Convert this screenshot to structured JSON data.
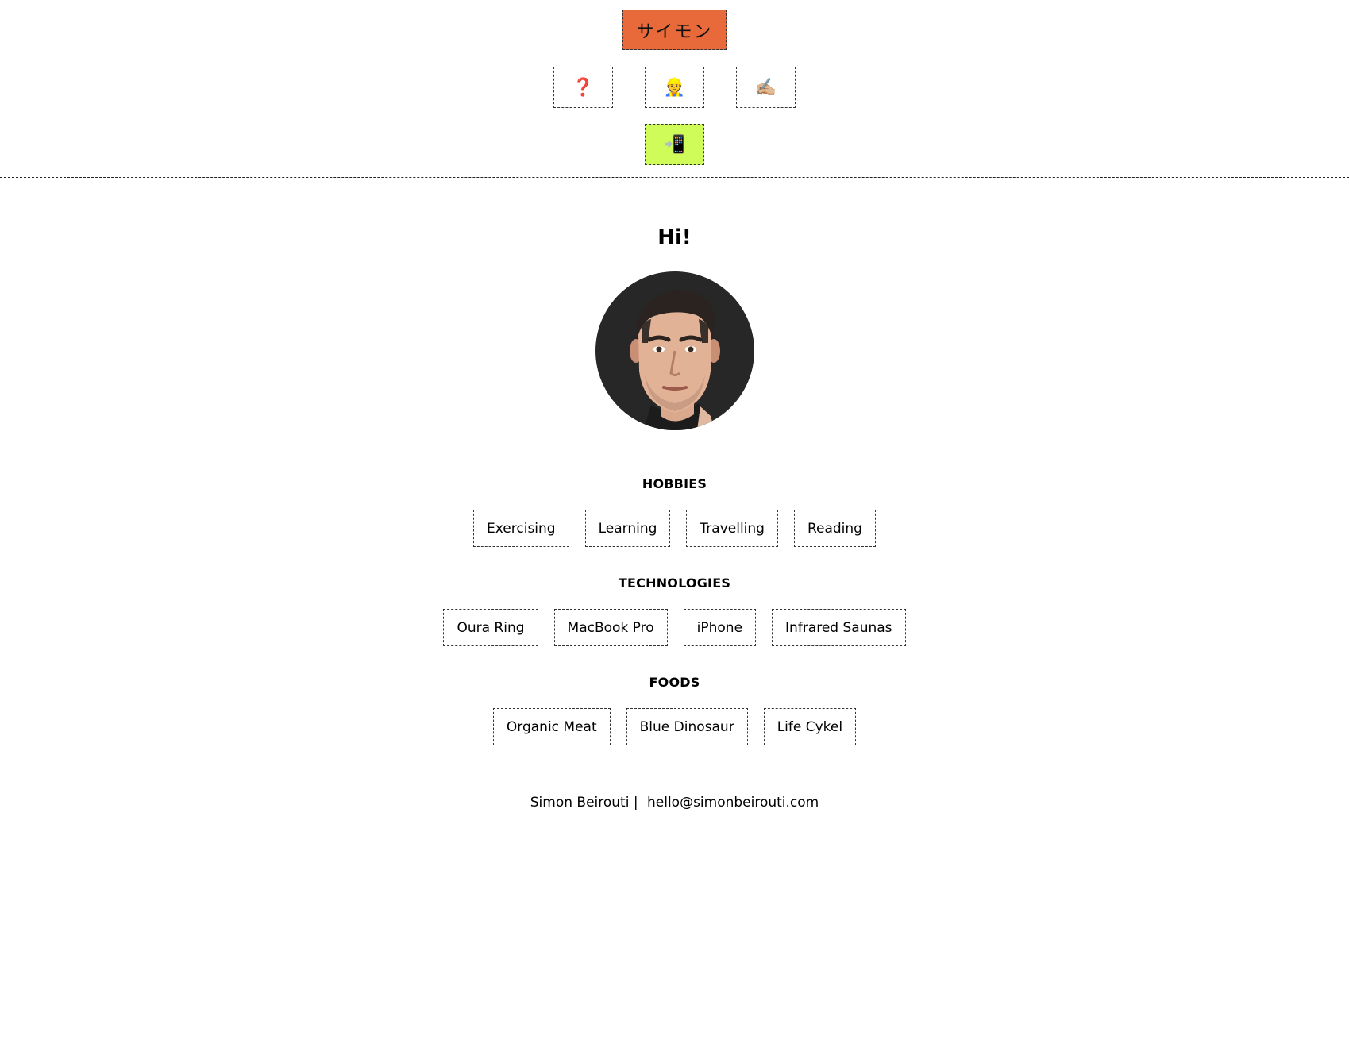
{
  "nav": {
    "brand_label": "サイモン",
    "icons": [
      {
        "glyph": "❓",
        "name": "question-icon"
      },
      {
        "glyph": "👷",
        "name": "worker-icon"
      },
      {
        "glyph": "✍🏼",
        "name": "writing-hand-icon"
      }
    ],
    "contact_icon": {
      "glyph": "📲",
      "name": "mobile-phone-arrow-icon"
    }
  },
  "hero": {
    "greeting": "Hi!"
  },
  "sections": {
    "hobbies": {
      "title": "HOBBIES",
      "items": [
        "Exercising",
        "Learning",
        "Travelling",
        "Reading"
      ]
    },
    "technologies": {
      "title": "TECHNOLOGIES",
      "items": [
        "Oura Ring",
        "MacBook Pro",
        "iPhone",
        "Infrared Saunas"
      ]
    },
    "foods": {
      "title": "FOODS",
      "items": [
        "Organic Meat",
        "Blue Dinosaur",
        "Life Cykel"
      ]
    }
  },
  "footer": {
    "name": "Simon Beirouti",
    "separator": "|",
    "email": "hello@simonbeirouti.com"
  },
  "colors": {
    "brand_button": "#e8693a",
    "active_button": "#d0fc5a",
    "avatar_background": "#272727"
  }
}
